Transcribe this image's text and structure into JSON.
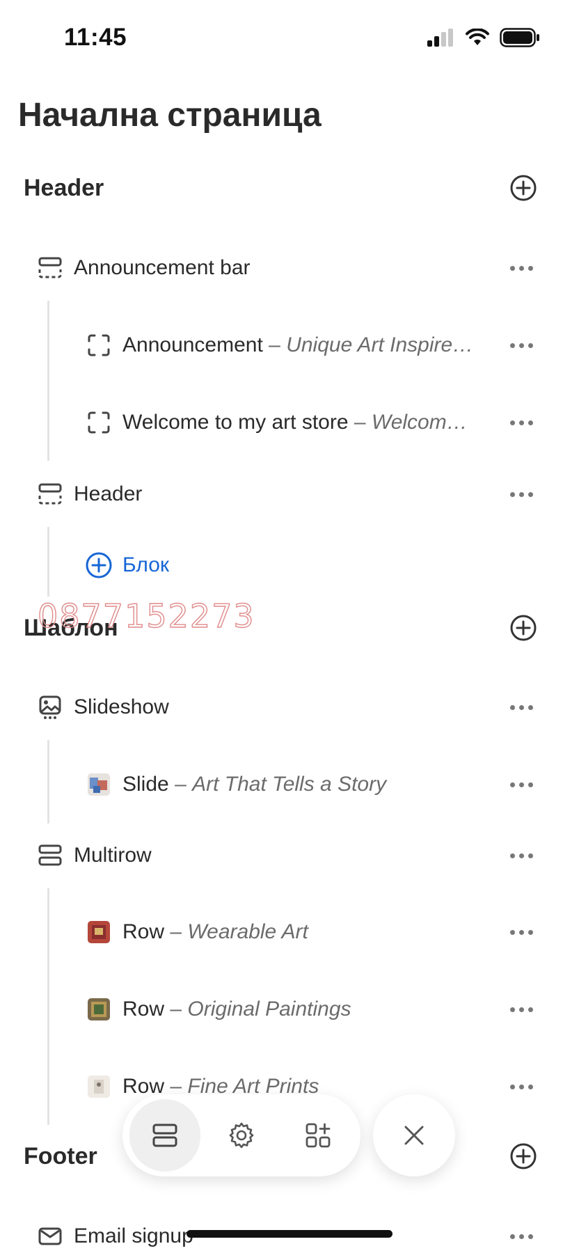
{
  "status_bar": {
    "time": "11:45"
  },
  "page": {
    "title": "Начална страница"
  },
  "sections": {
    "header": {
      "title": "Header",
      "items": {
        "announcement_bar": {
          "label": "Announcement bar",
          "children": [
            {
              "label": "Announcement",
              "sub": "Unique Art Inspire…"
            },
            {
              "label": "Welcome to my art store",
              "sub": "Welcom…"
            }
          ]
        },
        "header": {
          "label": "Header",
          "add_block_label": "Блок"
        }
      }
    },
    "template": {
      "title": "Шаблон",
      "items": {
        "slideshow": {
          "label": "Slideshow",
          "children": [
            {
              "label": "Slide",
              "sub": "Art That Tells a Story"
            }
          ]
        },
        "multirow": {
          "label": "Multirow",
          "children": [
            {
              "label": "Row",
              "sub": "Wearable Art"
            },
            {
              "label": "Row",
              "sub": "Original Paintings"
            },
            {
              "label": "Row",
              "sub": "Fine Art Prints"
            }
          ]
        }
      }
    },
    "footer": {
      "title": "Footer",
      "items": {
        "email_signup": {
          "label": "Email signup"
        }
      }
    }
  },
  "watermark": "0877152273",
  "separator": "–",
  "icons": {
    "add": "plus-circle-icon",
    "more": "ellipsis-icon",
    "section_group": "section-group-icon",
    "block": "block-frame-icon",
    "slideshow": "slideshow-icon",
    "email": "envelope-icon",
    "toolbar": [
      "sections-icon",
      "gear-icon",
      "add-app-icon"
    ],
    "close": "close-icon"
  },
  "colors": {
    "accent": "#1766d6",
    "text": "#2a2a2a",
    "muted": "#6b6b6b",
    "watermark": "#e08a8a"
  }
}
